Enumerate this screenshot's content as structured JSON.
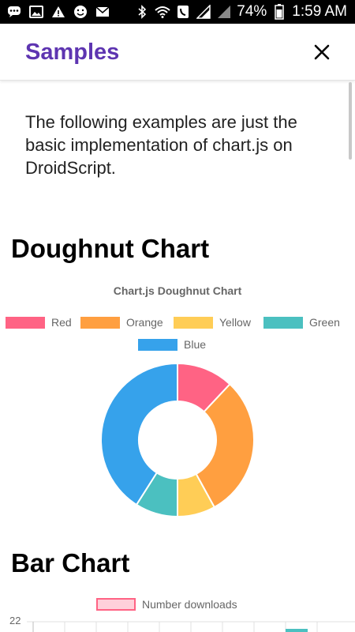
{
  "status_bar": {
    "battery": "74%",
    "time": "1:59 AM"
  },
  "appbar": {
    "title": "Samples"
  },
  "intro": "The following examples are just the basic implementation of chart.js on DroidScript.",
  "doughnut_section": {
    "heading": "Doughnut Chart"
  },
  "bar_section": {
    "heading": "Bar Chart"
  },
  "colors": {
    "title_purple": "#5e35b1",
    "red": "#ff6384",
    "orange": "#ff9f40",
    "yellow": "#ffcd56",
    "green": "#4bc0c0",
    "blue": "#36a2eb"
  },
  "chart_data": [
    {
      "type": "pie",
      "title": "Chart.js Doughnut Chart",
      "labels": [
        "Red",
        "Orange",
        "Yellow",
        "Green",
        "Blue"
      ],
      "values": [
        12,
        30,
        8,
        9,
        41
      ],
      "legend": "top"
    },
    {
      "type": "bar",
      "title": "",
      "series": [
        {
          "name": "Number downloads",
          "values": []
        }
      ],
      "y_tick_visible": "22",
      "legend": "top"
    }
  ]
}
